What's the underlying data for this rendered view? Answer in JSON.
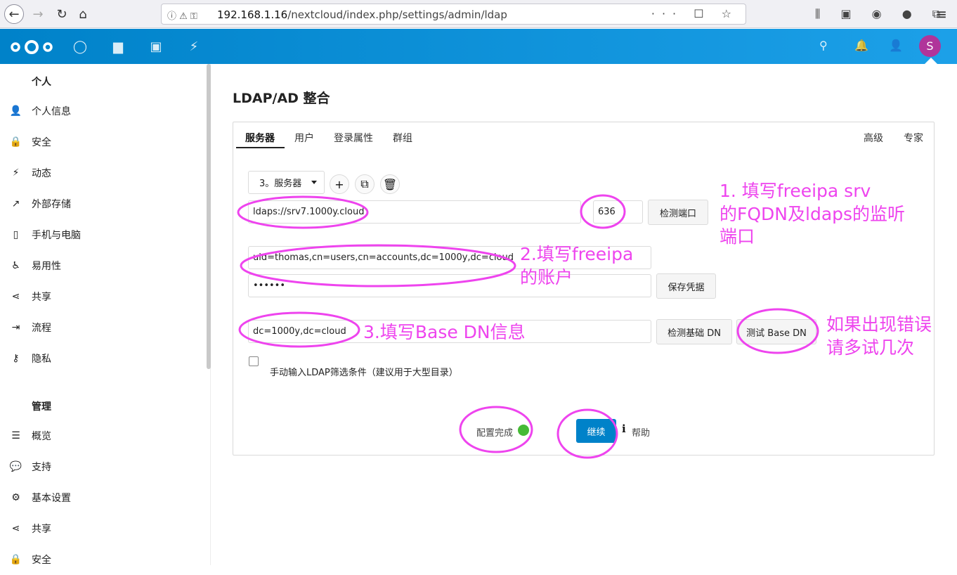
{
  "browser": {
    "url_host": "192.168.1.16",
    "url_path": "/nextcloud/index.php/settings/admin/ldap",
    "url_tail_icons": "··· ☐ ☆"
  },
  "header": {
    "apps": [
      "dashboard-icon",
      "files-icon",
      "photos-icon",
      "activity-icon"
    ],
    "avatar_letter": "S"
  },
  "sidebar": {
    "personal_heading": "个人",
    "personal_items": [
      {
        "icon": "user-icon",
        "glyph": "👤",
        "label": "个人信息"
      },
      {
        "icon": "lock-icon",
        "glyph": "🔒",
        "label": "安全"
      },
      {
        "icon": "activity-icon",
        "glyph": "⚡",
        "label": "动态"
      },
      {
        "icon": "external-storage-icon",
        "glyph": "↗",
        "label": "外部存储"
      },
      {
        "icon": "phone-icon",
        "glyph": "▯",
        "label": "手机与电脑"
      },
      {
        "icon": "accessibility-icon",
        "glyph": "♿",
        "label": "易用性"
      },
      {
        "icon": "share-icon",
        "glyph": "⋖",
        "label": "共享"
      },
      {
        "icon": "flow-icon",
        "glyph": "⇥",
        "label": "流程"
      },
      {
        "icon": "key-icon",
        "glyph": "⚷",
        "label": "隐私"
      }
    ],
    "admin_heading": "管理",
    "admin_items": [
      {
        "icon": "overview-icon",
        "glyph": "☰",
        "label": "概览"
      },
      {
        "icon": "support-icon",
        "glyph": "💬",
        "label": "支持"
      },
      {
        "icon": "settings-icon",
        "glyph": "⚙",
        "label": "基本设置"
      },
      {
        "icon": "share-icon",
        "glyph": "⋖",
        "label": "共享"
      },
      {
        "icon": "lock-icon",
        "glyph": "🔒",
        "label": "安全"
      }
    ]
  },
  "main": {
    "title": "LDAP/AD 整合",
    "tabs": [
      "服务器",
      "用户",
      "登录属性",
      "群组"
    ],
    "tabs_right": [
      "高级",
      "专家"
    ],
    "server_select": "3。服务器",
    "host_value": "ldaps://srv7.1000y.cloud",
    "port_value": "636",
    "detect_port_label": "检测端口",
    "user_dn_value": "uid=thomas,cn=users,cn=accounts,dc=1000y,dc=cloud",
    "password_value": "••••••",
    "save_credentials_label": "保存凭据",
    "base_dn_value": "dc=1000y,dc=cloud",
    "detect_base_dn_label": "检测基础 DN",
    "test_base_dn_label": "测试 Base DN",
    "manual_filter_label": "手动输入LDAP筛选条件（建议用于大型目录）",
    "config_status": "配置完成",
    "continue_label": "继续",
    "help_label": "帮助"
  },
  "annotations": {
    "note1": "1. 填写freeipa srv\n的FQDN及ldaps的监听\n端口",
    "note2": "2.填写freeipa\n的账户",
    "note3": "3.填写Base DN信息",
    "note4": "如果出现错误\n请多试几次",
    "color": "#ee44ee"
  }
}
